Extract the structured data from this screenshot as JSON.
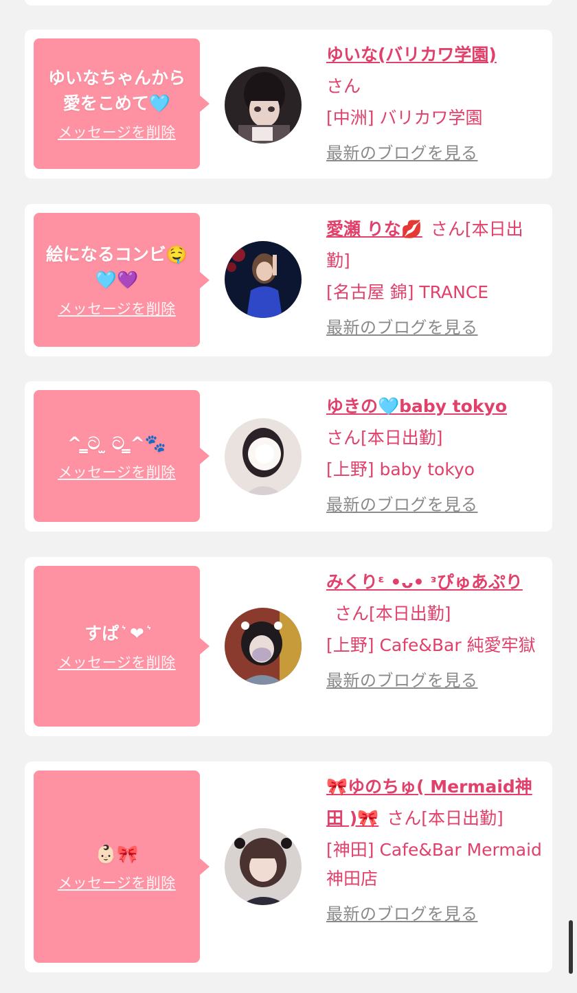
{
  "common": {
    "delete_label": "メッセージを削除",
    "blog_label": "最新のブログを見る"
  },
  "cards": [
    {
      "message": "ゆいなちゃんから\n愛をこめて🩵",
      "name": "ゆいな(バリカワ学園)",
      "san": "さん",
      "shop": "[中洲] バリカワ学園"
    },
    {
      "message": "絵になるコンビ🤤\n🩵💜",
      "name": "愛瀬 りな💋",
      "san": "さん[本日出勤]",
      "shop": "[名古屋 錦] TRANCE"
    },
    {
      "message": "^ ̳ට ̫ ට ̳^🐾",
      "name": "ゆきの🩵baby tokyo",
      "san": "さん[本日出勤]",
      "shop": "[上野] baby tokyo"
    },
    {
      "message": "すぱ ͛ ❤︎ ͛",
      "name": "みくりᵋ •ᴗ• ᵌぴゅあぷり",
      "san": "さん[本日出勤]",
      "shop": "[上野] Cafe&Bar 純愛牢獄"
    },
    {
      "message": "👶🏻🎀",
      "name": "🎀ゆのちゅ( Mermaid神田 )🎀",
      "san": "さん[本日出勤]",
      "shop": "[神田] Cafe&Bar Mermaid 神田店"
    }
  ],
  "colors": {
    "bubble": "#fe91a2",
    "accent": "#e0406a",
    "link_gray": "#8a8a8a",
    "background": "#f2f2f2"
  }
}
